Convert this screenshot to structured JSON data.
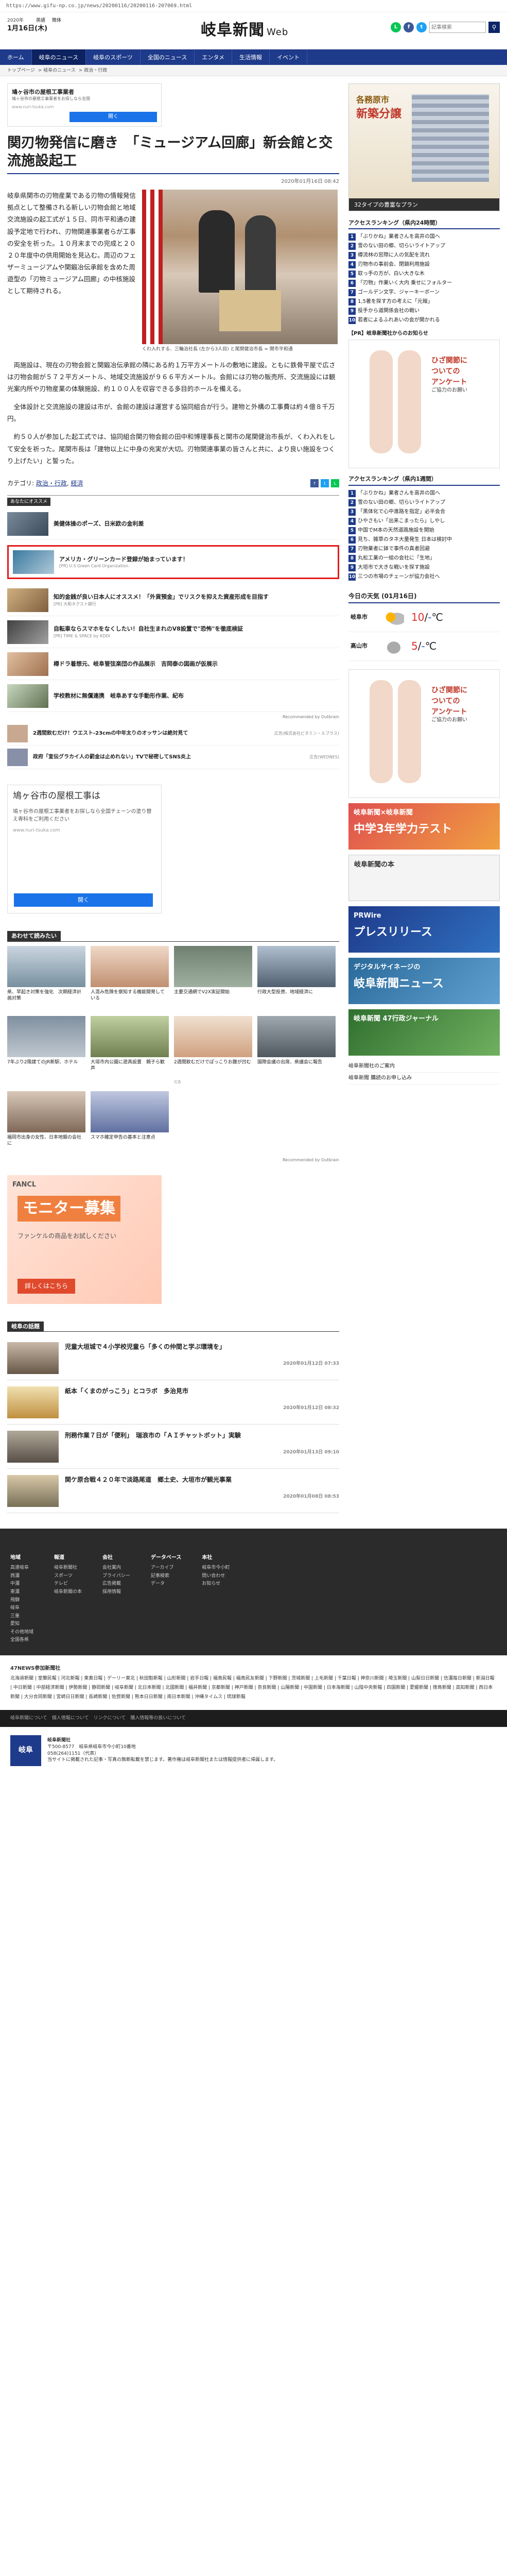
{
  "url": "https://www.gifu-np.co.jp/news/20200116/20200116-207069.html",
  "header": {
    "date_small": "2020年",
    "date": "1月16日(木)",
    "lang": [
      "英語",
      "簡体"
    ],
    "logo": "岐阜新聞",
    "logo_sub": "Web",
    "search_placeholder": "記事検索"
  },
  "nav": [
    "ホーム",
    "岐阜のニュース",
    "岐阜のスポーツ",
    "全国のニュース",
    "エンタメ",
    "生活情報",
    "イベント"
  ],
  "breadcrumb": [
    "トップページ",
    "岐阜のニュース",
    "政治・行政"
  ],
  "topad": {
    "title": "鳩ヶ谷市の屋根工事業者",
    "desc": "鳩ヶ谷市の屋根工事業者をお探しなら全国",
    "url": "www.nuri-tsuka.com",
    "button": "開く"
  },
  "article": {
    "title": "関刃物発信に磨き　「ミュージアム回廊」新会館と交流施設起工",
    "date": "2020年01月16日 08:42",
    "lead": "岐阜県関市の刃物産業である刃物の情報発信拠点として整備される新しい刃物会館と地域交流施設の起工式が１５日、同市平和通の建設予定地で行われ、刃物関連事業者らが工事の安全を祈った。１０月末までの完成と２０２０年度中の供用開始を見込む。周辺のフェザーミュージアムや関鍛冶伝承館を含めた周遊型の「刃物ミュージアム回廊」の中核施設として期待される。",
    "caption": "くわ入れする、三輪治社長 (左から3人目) と尾関健治市長 = 関市平和通",
    "p1": "両施設は、現在の刃物会館と関鍛冶伝承館の隣にある約１万平方メートルの敷地に建設。ともに鉄骨平屋で広さは刃物会館が５７２平方メートル、地域交流施設が９６６平方メートル。会館には刃物の販売所、交流施設には観光案内所や刃物産業の体験施設、約１００人を収容できる多目的ホールを備える。",
    "p2": "全体設計と交流施設の建設は市が、会館の建設は運営する協同組合が行う。建物と外構の工事費は約４億８千万円。",
    "p3": "約５０人が参加した起工式では、協同組合関刃物会館の田中和博理事長と関市の尾関健治市長が、くわ入れをして安全を祈った。尾関市長は「建物以上に中身の充実が大切。刃物関連事業の皆さんと共に、より良い施設をつくり上げたい」と誓った。",
    "category_label": "カテゴリ:",
    "category_links": [
      "政治・行政",
      "経済"
    ]
  },
  "reco": {
    "header": "あなたにオススメ",
    "items": [
      {
        "title": "美健体操のポーズ、日米欧の金利差",
        "sponsor": ""
      },
      {
        "title": "アメリカ・グリーンカード登録が始まっています！",
        "sponsor": "[PR] U.S Green Card Organization"
      },
      {
        "title": "知的金銭が良い日本人にオススメ！「外貨預金」でリスクを抑えた資産形成を目指す",
        "sponsor": "[PR] 大和ネクスト銀行"
      },
      {
        "title": "自転車ならスマホをなくしたい！自社生まれのV8設置で\"恐怖\"を徹底検証",
        "sponsor": "[PR] TIME & SPACE by KDDI"
      },
      {
        "title": "樽ドラ着想元、岐阜管弦楽団の作品展示　吉岡泰の図画が仮展示",
        "sponsor": ""
      },
      {
        "title": "学校教材に無償連携　岐阜あすな手動形作業、紀布",
        "sponsor": ""
      }
    ],
    "powered": "Recommended by Outbrain"
  },
  "related": [
    {
      "title": "2週間飲むだけ！ウエスト-23cmの中年太りのオッサンは絶対見て",
      "src": "広告(株式会社ビタミン・ルプラス)"
    },
    {
      "title": "政府「宣伝グラカイ人の罰金は止めれない」TVで秘密してSNS炎上",
      "src": "広告(WEDNES)"
    }
  ],
  "bigad": {
    "title": "鳩ヶ谷市の屋根工事は",
    "desc": "鳩ヶ谷市の屋根工事業者をお探しなら全国チェーンの塗り替え専科をご利用ください",
    "url": "www.nuri-tsuka.com",
    "button": "開く"
  },
  "grid": {
    "header": "あわせて読みたい",
    "items": [
      {
        "title": "県、早起き対策を強化　次期経済計画対策",
        "src": ""
      },
      {
        "title": "人混み危険を察知する機能開発している",
        "src": ""
      },
      {
        "title": "主要交通網でV2X実証開始",
        "src": ""
      },
      {
        "title": "行政大型投資、地域経済に",
        "src": ""
      },
      {
        "title": "7年ぶり2階建てのJR新駅、ホテル",
        "src": ""
      },
      {
        "title": "大垣市内公園に遊具設置　親子ら歓声",
        "src": ""
      },
      {
        "title": "2週間飲むだけでぽっこりお腹が凹む",
        "src": "広告"
      },
      {
        "title": "国際会議の出席、県議会に報告",
        "src": ""
      },
      {
        "title": "福岡市出身の女性、日本地銀の会社に",
        "src": ""
      },
      {
        "title": "スマホ確定申告の基本と注意点",
        "src": ""
      }
    ],
    "powered": "Recommended by Outbrain"
  },
  "fancl": {
    "brand": "FANCL",
    "title": "モニター募集",
    "sub": "ファンケルの商品をお試しください",
    "cta": "詳しくはこちら"
  },
  "local": {
    "header": "岐阜の話題",
    "items": [
      {
        "title": "児童大垣城で４小学校児童ら「多くの仲間と学ぶ環境を」",
        "date": "2020年01月12日 07:33"
      },
      {
        "title": "紙本「くまのがっこう」とコラボ　多治見市",
        "date": "2020年01月12日 08:32"
      },
      {
        "title": "刑務作業７日が「便利」　瑞浪市の「ＡＩチャットボット」実験",
        "date": "2020年01月13日 09:10"
      },
      {
        "title": "関ケ原合戦４２０年で淡路尾道　郷土史、大垣市が観光事業",
        "date": "2020年01月08日 08:53"
      }
    ]
  },
  "side": {
    "banner": {
      "title": "各務原市",
      "title2": "新築分譲",
      "footer": "32タイプの豊富なプラン"
    },
    "rank1_header": "アクセスランキング（県内24時間）",
    "rank1": [
      "「ぶりかね」業者さんを高井の国へ",
      "雪のない田の郷、切らいライトアップ",
      "樽流林の窓際に人の気配を流れ",
      "刃物市の事前会、閉鎖利用施設",
      "取っ手の方が、白い大きな木",
      "「刃物」作業いく大内 乗せにフォルター",
      "ゴールデン文字、ジャーキーボーン",
      "1,5著を探す方の考えに「元報」",
      "投手から道関係会社の戦い",
      "若者によるふれあいの会が開かれる"
    ],
    "pr_header": "【PR】岐阜新聞社からのお知らせ",
    "legs": {
      "title": "ひざ関節に\nついての\nアンケート",
      "sub": "ご協力のお願い"
    },
    "rank2_header": "アクセスランキング（県内1週間）",
    "rank2": [
      "「ぶりかね」業者さんを高井の国へ",
      "雪のない田の郷、切らいライトアップ",
      "「黒体化で心中進路を指定」必半会合",
      "ひやさもい「出来こまったら」しやし",
      "中国でM本の天然道路施設を開始",
      "見ち、雑草のタネ大量発生 日本は検討中",
      "刃物業者に鉢で事件の真者回避",
      "丸松工業の一組の会社に「生地」",
      "大垣市で大きな戦いを探す施設",
      "三つの市場のチェーンが協力会社へ"
    ],
    "weather": {
      "header": "今日の天気 (01月16日)",
      "rows": [
        {
          "city": "岐阜市",
          "hi": "10",
          "lo": "-"
        },
        {
          "city": "高山市",
          "hi": "5",
          "lo": "-"
        }
      ]
    },
    "legs2": {
      "title": "ひざ関節に\nついての\nアンケート",
      "sub": "ご協力のお願い"
    },
    "promos": [
      {
        "t": "岐阜新聞×岐阜新聞",
        "t2": "中学3年学力テスト"
      },
      {
        "t": "岐阜新聞の本",
        "t2": ""
      },
      {
        "t": "PRWire",
        "t2": "プレスリリース"
      },
      {
        "t": "デジタルサイネージの",
        "t2": "岐阜新聞ニュース"
      },
      {
        "t": "岐阜新聞 47行政ジャーナル",
        "t2": ""
      }
    ],
    "links": [
      "岐阜新聞社のご案内",
      "岐阜新聞 購読のお申し込み"
    ]
  },
  "footer": {
    "cols": [
      {
        "h": "地域",
        "items": [
          "高速岐阜",
          "西濃",
          "中濃",
          "東濃",
          "飛騨",
          "岐阜",
          "三重",
          "愛知",
          "その他地域",
          "全国各県"
        ]
      },
      {
        "h": "報道",
        "items": [
          "岐阜新聞社",
          "スポーツ",
          "テレビ",
          "岐阜新聞の本"
        ]
      },
      {
        "h": "会社",
        "items": [
          "会社案内",
          "プライバシー",
          "広告掲載",
          "採用情報"
        ]
      },
      {
        "h": "データベース",
        "items": [
          "アーカイブ",
          "記事検索",
          "データ"
        ]
      },
      {
        "h": "本社",
        "items": [
          "岐阜市今小町",
          "問い合わせ",
          "お知らせ"
        ]
      }
    ],
    "news_header": "47NEWS参加新聞社",
    "news": "北海道新聞 | 室蘭民報 | 河北新報 | 東奥日報 | デーリー東北 | 秋田魁新報 | 山形新聞 | 岩手日報 | 福島民報 | 福島民友新聞 | 下野新聞 | 茨城新聞 | 上毛新聞 | 千葉日報 | 神奈川新聞 | 埼玉新聞 | 山梨日日新聞 | 信濃毎日新聞 | 新潟日報 | 中日新聞 | 中部経済新聞 | 伊勢新聞 | 静岡新聞 | 岐阜新聞 | 北日本新聞 | 北國新聞 | 福井新聞 | 京都新聞 | 神戸新聞 | 奈良新聞 | 山陽新聞 | 中国新聞 | 日本海新聞 | 山陰中央新報 | 四国新聞 | 愛媛新聞 | 徳島新聞 | 高知新聞 | 西日本新聞 | 大分合同新聞 | 宮崎日日新聞 | 長崎新聞 | 佐賀新聞 | 熊本日日新聞 | 南日本新聞 | 沖縄タイムス | 琉球新報",
    "bottom": "岐阜新聞について　個人情報について　リンクについて　購入情報等の扱いについて",
    "corp_name": "岐阜新聞社",
    "corp_addr": "〒500-8577　岐阜県岐阜市今小町10番地",
    "corp_tel": "058(264)1151（代表）",
    "corp_note": "当サイトに掲載された記事・写真の無断転載を禁じます。著作権は岐阜新聞社または情報提供者に帰属します。"
  }
}
